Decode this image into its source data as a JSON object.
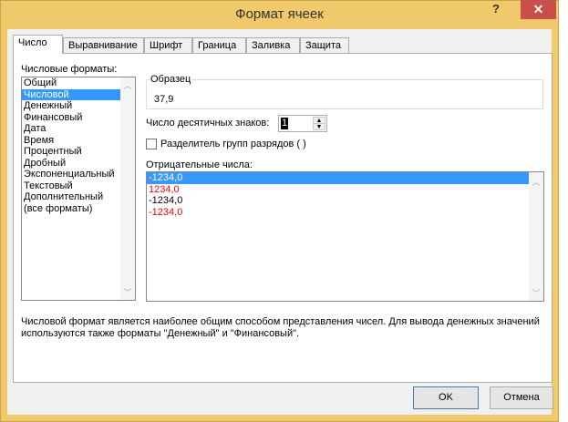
{
  "window": {
    "title": "Формат ячеек",
    "help": "?",
    "close": "✕"
  },
  "tabs": [
    "Число",
    "Выравнивание",
    "Шрифт",
    "Граница",
    "Заливка",
    "Защита"
  ],
  "formats": {
    "label": "Числовые форматы:",
    "items": [
      "Общий",
      "Числовой",
      "Денежный",
      "Финансовый",
      "Дата",
      "Время",
      "Процентный",
      "Дробный",
      "Экспоненциальный",
      "Текстовый",
      "Дополнительный",
      "(все форматы)"
    ],
    "selected": 1
  },
  "sample": {
    "label": "Образец",
    "value": "37,9"
  },
  "decimals": {
    "label": "Число десятичных знаков:",
    "value": "1"
  },
  "separator": {
    "label": "Разделитель групп разрядов ( )",
    "checked": false
  },
  "negative": {
    "label": "Отрицательные числа:",
    "items": [
      {
        "text": "-1234,0",
        "color": "#ffffff"
      },
      {
        "text": "1234,0",
        "color": "#ff0000"
      },
      {
        "text": "-1234,0",
        "color": "#000000"
      },
      {
        "text": "-1234,0",
        "color": "#ff0000"
      }
    ],
    "selected": 0
  },
  "description": {
    "line1": "Числовой формат является наиболее общим способом представления чисел. Для вывода денежных значений",
    "line2": "используются также форматы \"Денежный\" и \"Финансовый\"."
  },
  "buttons": {
    "ok": "OK",
    "cancel": "Отмена"
  }
}
